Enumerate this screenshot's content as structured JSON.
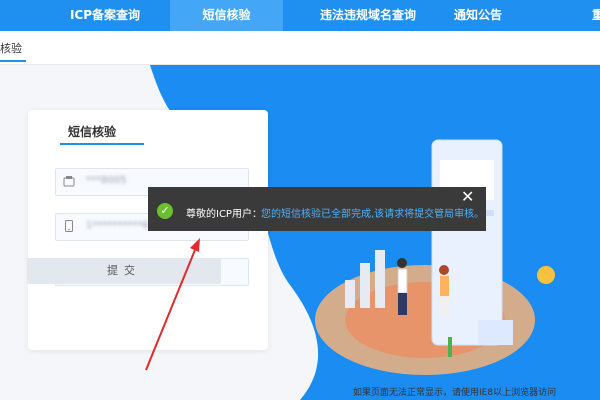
{
  "nav": {
    "items": [
      {
        "label": "ICP备案查询",
        "active": false
      },
      {
        "label": "短信核验",
        "active": true
      },
      {
        "label": "违法违规域名查询",
        "active": false
      },
      {
        "label": "通知公告",
        "active": false
      },
      {
        "label": "重",
        "active": false
      }
    ]
  },
  "breadcrumb": {
    "current": "核验"
  },
  "card": {
    "title": "短信核验",
    "fields": [
      {
        "icon": "phone-icon",
        "value": "***8005"
      },
      {
        "icon": "mobile-icon",
        "value": "1**********6"
      },
      {
        "icon": "id-card-icon",
        "value": "******"
      }
    ],
    "submit_label": "提交"
  },
  "toast": {
    "prefix": "尊敬的ICP用户：",
    "message": "您的短信核验已全部完成,该请求将提交管局审核。",
    "close_label": "✕"
  },
  "footer_note": "如果页面无法正常显示，请使用IE8以上浏览器访问",
  "colors": {
    "brand": "#1f8ff0",
    "success": "#6cbf2e",
    "toast_link": "#4db4ff"
  }
}
